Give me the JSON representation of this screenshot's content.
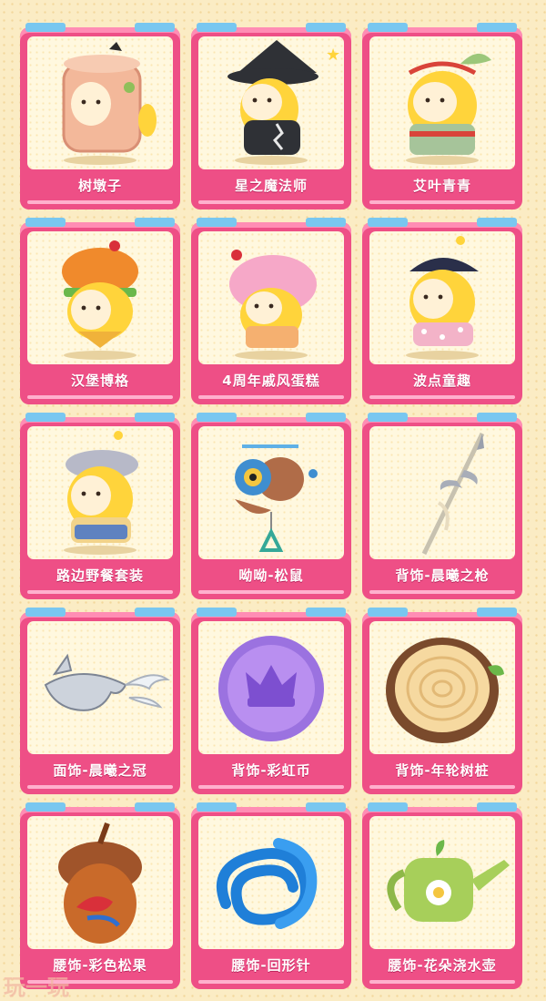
{
  "items": [
    {
      "label": "树墩子",
      "icon": "tree-stump-costume-icon"
    },
    {
      "label": "星之魔法师",
      "icon": "star-wizard-costume-icon"
    },
    {
      "label": "艾叶青青",
      "icon": "mugwort-costume-icon"
    },
    {
      "label": "汉堡博格",
      "icon": "hamburger-costume-icon"
    },
    {
      "label": "4周年戚风蛋糕",
      "icon": "chiffon-cake-costume-icon"
    },
    {
      "label": "波点童趣",
      "icon": "polka-dot-costume-icon"
    },
    {
      "label": "路边野餐套装",
      "icon": "picnic-costume-icon"
    },
    {
      "label": "呦呦-松鼠",
      "icon": "squirrel-pet-icon"
    },
    {
      "label": "背饰-晨曦之枪",
      "icon": "spear-back-accessory-icon"
    },
    {
      "label": "面饰-晨曦之冠",
      "icon": "crown-face-accessory-icon"
    },
    {
      "label": "背饰-彩虹币",
      "icon": "rainbow-coin-icon"
    },
    {
      "label": "背饰-年轮树桩",
      "icon": "tree-ring-stump-icon"
    },
    {
      "label": "腰饰-彩色松果",
      "icon": "acorn-waist-accessory-icon"
    },
    {
      "label": "腰饰-回形针",
      "icon": "paperclip-waist-accessory-icon"
    },
    {
      "label": "腰饰-花朵浇水壶",
      "icon": "watering-can-icon"
    }
  ],
  "watermark": "玩一玩"
}
